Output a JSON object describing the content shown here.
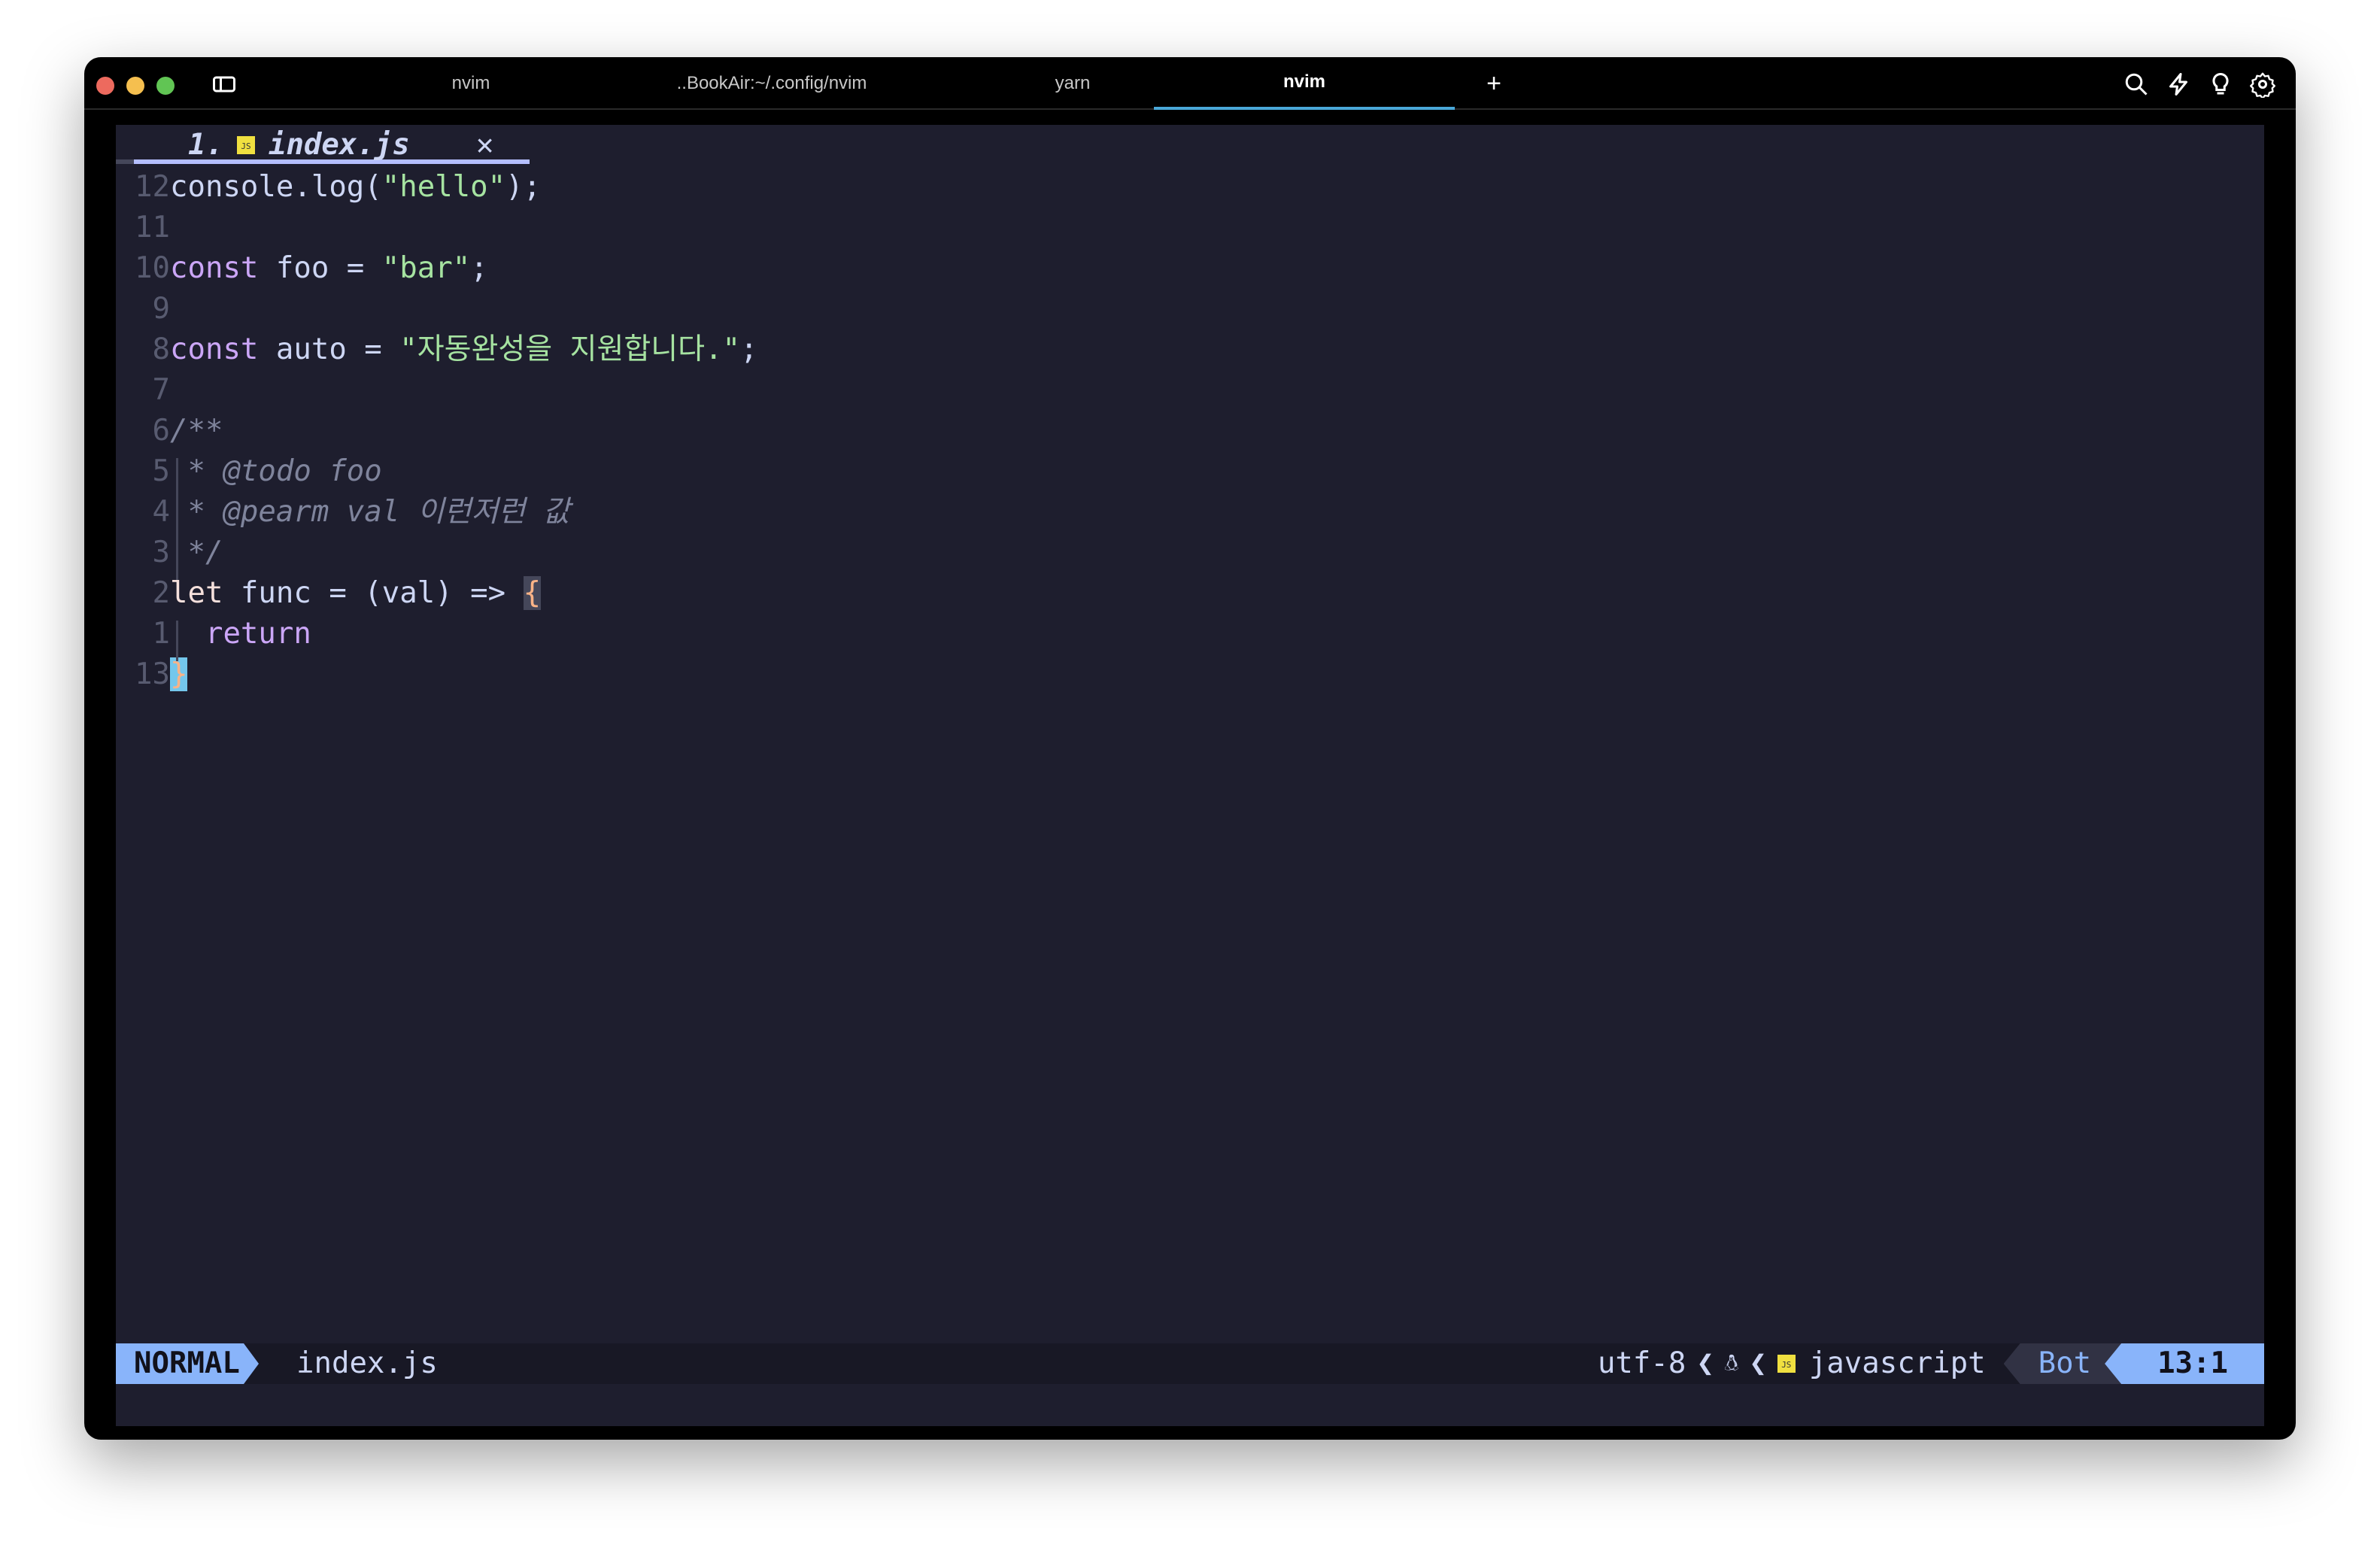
{
  "window": {
    "tabs": [
      {
        "label": "nvim"
      },
      {
        "label": "..BookAir:~/.config/nvim"
      },
      {
        "label": "yarn"
      },
      {
        "label": "nvim",
        "active": true
      }
    ],
    "new_tab": "+",
    "icons": [
      "search-icon",
      "bolt-icon",
      "lightbulb-icon",
      "gear-icon"
    ]
  },
  "buffer_tab": {
    "number": "1.",
    "icon": "JS",
    "name": "index.js",
    "close": "✕"
  },
  "lines": [
    {
      "n": "12",
      "code": [
        [
          "",
          "console.log("
        ],
        [
          "str",
          "\"hello\""
        ],
        [
          "",
          ");"
        ]
      ]
    },
    {
      "n": "11",
      "code": []
    },
    {
      "n": "10",
      "code": [
        [
          "kw",
          "const"
        ],
        [
          "",
          " foo = "
        ],
        [
          "str",
          "\"bar\""
        ],
        [
          "",
          ";"
        ]
      ]
    },
    {
      "n": "9",
      "code": []
    },
    {
      "n": "8",
      "code": [
        [
          "kw",
          "const"
        ],
        [
          "",
          " auto = "
        ],
        [
          "str",
          "\"자동완성을 지원합니다.\""
        ],
        [
          "",
          ";"
        ]
      ]
    },
    {
      "n": "7",
      "code": []
    },
    {
      "n": "6",
      "code": [
        [
          "cm",
          "/**"
        ]
      ]
    },
    {
      "n": "5",
      "code": [
        [
          "cm",
          " * @todo foo"
        ]
      ]
    },
    {
      "n": "4",
      "code": [
        [
          "cm",
          " * @pearm val 이런저런 값"
        ]
      ]
    },
    {
      "n": "3",
      "code": [
        [
          "cm",
          " */"
        ]
      ]
    },
    {
      "n": "2",
      "code": [
        [
          "let",
          "let"
        ],
        [
          "",
          " func = (val) => "
        ],
        [
          "br",
          "{"
        ]
      ]
    },
    {
      "n": "1",
      "code": [
        [
          "kw",
          "  return"
        ]
      ]
    },
    {
      "n": "13",
      "code": [
        [
          "br",
          "}"
        ]
      ]
    }
  ],
  "status": {
    "mode": "NORMAL",
    "file": "index.js",
    "encoding": "utf-8",
    "os_icon": "linux-icon",
    "ft_icon": "JS",
    "filetype": "javascript",
    "position": "Bot",
    "cursor": "13:1"
  },
  "colors": {
    "bg": "#1e1e2e",
    "mode": "#89b4fa",
    "cursor": "#74c7ec",
    "string": "#a6e3a1",
    "keyword": "#cba6f7"
  }
}
